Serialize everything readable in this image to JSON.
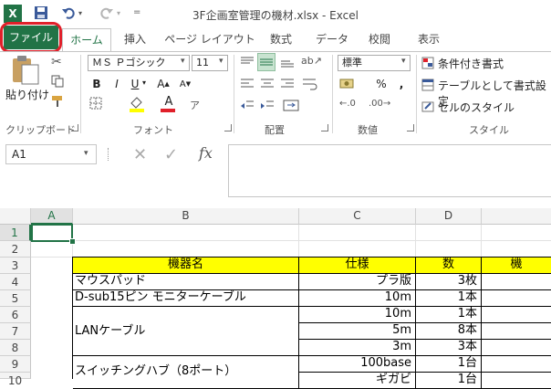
{
  "title": "3F企画室管理の機材.xlsx - Excel",
  "tabs": {
    "file": "ファイル",
    "home": "ホーム",
    "insert": "挿入",
    "page_layout": "ページ レイアウト",
    "formulas": "数式",
    "data": "データ",
    "review": "校閲",
    "view": "表示"
  },
  "ribbon": {
    "paste_label": "貼り付け",
    "font_name": "ＭＳ Ｐゴシック",
    "font_size": "11",
    "number_format": "標準",
    "conditional_format": "条件付き書式",
    "format_as_table": "テーブルとして書式設定",
    "cell_styles": "セルのスタイル",
    "groups": {
      "clipboard": "クリップボード",
      "font": "フォント",
      "alignment": "配置",
      "number": "数値",
      "styles": "スタイル"
    }
  },
  "formula_bar": {
    "name_box": "A1",
    "fx": "fx",
    "value": ""
  },
  "columns": [
    "A",
    "B",
    "C",
    "D"
  ],
  "rows": [
    "1",
    "2",
    "3",
    "4",
    "5",
    "6",
    "7",
    "8",
    "9",
    "10"
  ],
  "sheet": {
    "header": {
      "name": "機器名",
      "spec": "仕様",
      "qty": "数",
      "extra": "機"
    },
    "r4": {
      "name": "マウスパッド",
      "spec": "プラ版",
      "qty": "3枚"
    },
    "r5": {
      "name": "D-sub15ピン モニターケーブル",
      "spec": "10m",
      "qty": "1本"
    },
    "r6": {
      "spec": "10m",
      "qty": "1本"
    },
    "r7": {
      "name": "LANケーブル",
      "spec": "5m",
      "qty": "8本"
    },
    "r8": {
      "spec": "3m",
      "qty": "3本"
    },
    "r9": {
      "spec": "100base",
      "qty": "1台"
    },
    "r10": {
      "name": "スイッチングハブ（8ポート）",
      "spec": "ギガビ",
      "qty": "1台"
    }
  },
  "colors": {
    "accent": "#217346",
    "header_fill": "#ffff00",
    "highlight": "#e0202a"
  }
}
